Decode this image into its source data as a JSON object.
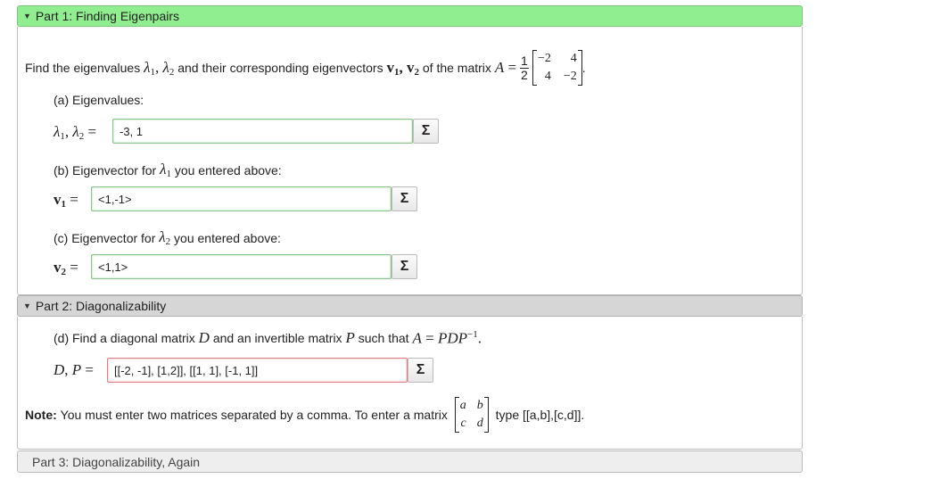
{
  "part1": {
    "title": "Part 1: Finding Eigenpairs",
    "question": "Find the eigenvalues λ1, λ2 and their corresponding eigenvectors v1, v2 of the matrix A = ",
    "q_prefix": "Find the eigenvalues",
    "q_mid1": "and their corresponding eigenvectors",
    "q_mid2": "of the matrix",
    "matrix_scalar_num": "1",
    "matrix_scalar_den": "2",
    "matrix": [
      "−2",
      "4",
      "4",
      "−2"
    ],
    "a_label": "(a) Eigenvalues:",
    "a_value": "-3, 1",
    "b_label_pre": "(b) Eigenvector for",
    "b_label_post": "you entered above:",
    "b_value": "<1,-1>",
    "c_label_pre": "(c) Eigenvector for",
    "c_label_post": "you entered above:",
    "c_value": "<1,1>"
  },
  "part2": {
    "title": "Part 2: Diagonalizability",
    "d_label_pre": "(d) Find a diagonal matrix",
    "d_label_mid1": "and an invertible matrix",
    "d_label_mid2": "such that",
    "d_value": "[[-2, -1], [1,2]], [[1, 1], [-1, 1]]",
    "note_bold": "Note:",
    "note_text": "You must enter two matrices separated by a comma. To enter a matrix",
    "note_matrix": [
      "a",
      "b",
      "c",
      "d"
    ],
    "note_tail": "type [[a,b],[c,d]]."
  },
  "part3": {
    "title": "Part 3: Diagonalizability, Again"
  },
  "sigma_symbol": "Σ",
  "colors": {
    "part1_header": "#90ee90",
    "part2_header": "#d6d6d6",
    "correct_border": "#8cc38c",
    "incorrect_border": "#e08080"
  }
}
